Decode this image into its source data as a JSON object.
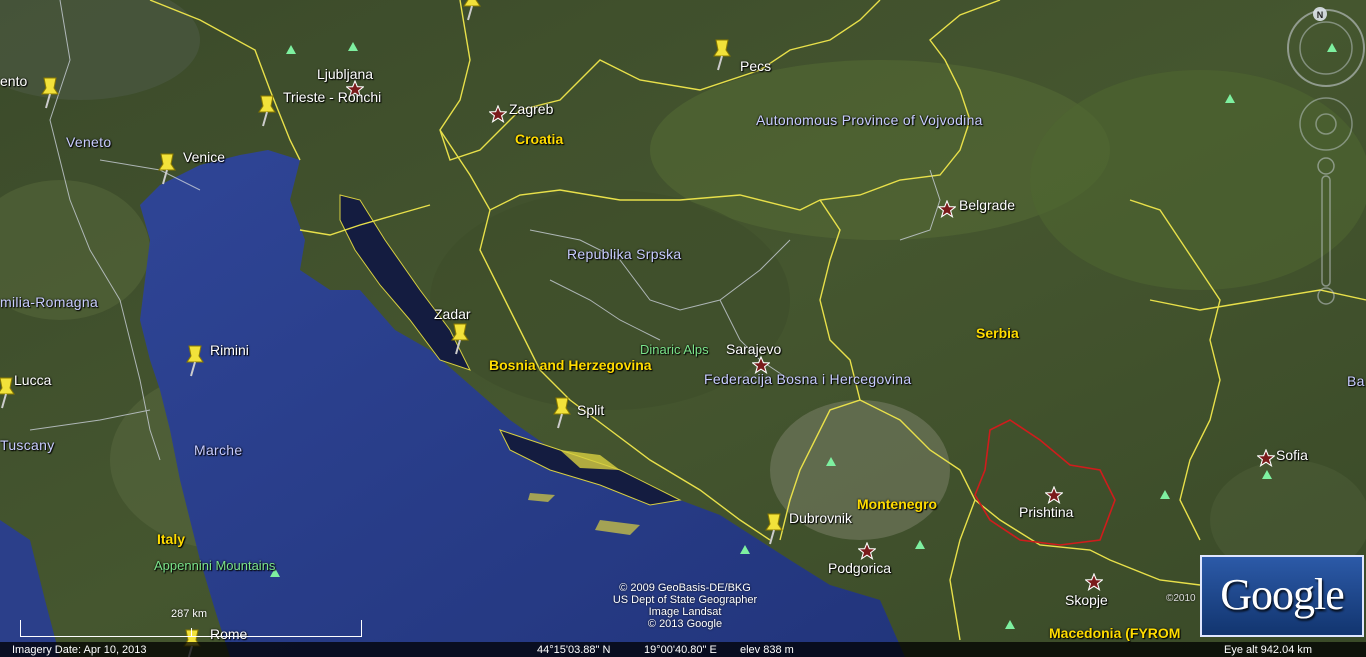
{
  "map": {
    "labels": [
      {
        "key": "Ljubljana",
        "text": "Ljubljana",
        "cls": "city",
        "name": "label-ljubljana"
      },
      {
        "key": "TriesteRonchi",
        "text": "Trieste - Ronchi",
        "cls": "city",
        "name": "label-trieste-ronchi"
      },
      {
        "key": "Zagreb",
        "text": "Zagreb",
        "cls": "city",
        "name": "label-zagreb"
      },
      {
        "key": "Croatia",
        "text": "Croatia",
        "cls": "country",
        "name": "label-croatia"
      },
      {
        "key": "Pecs",
        "text": "Pecs",
        "cls": "city",
        "name": "label-pecs"
      },
      {
        "key": "Vojvodina",
        "text": "Autonomous Province of Vojvodina",
        "cls": "region",
        "name": "label-vojvodina"
      },
      {
        "key": "Belgrade",
        "text": "Belgrade",
        "cls": "city",
        "name": "label-belgrade"
      },
      {
        "key": "Veneto",
        "text": "Veneto",
        "cls": "region",
        "name": "label-veneto"
      },
      {
        "key": "Venice",
        "text": "Venice",
        "cls": "city",
        "name": "label-venice"
      },
      {
        "key": "ento",
        "text": "ento",
        "cls": "city",
        "name": "label-ento"
      },
      {
        "key": "EmiliaRomagna",
        "text": "milia-Romagna",
        "cls": "region",
        "name": "label-emilia-romagna"
      },
      {
        "key": "Rimini",
        "text": "Rimini",
        "cls": "city",
        "name": "label-rimini"
      },
      {
        "key": "Lucca",
        "text": "Lucca",
        "cls": "city",
        "name": "label-lucca"
      },
      {
        "key": "Tuscany",
        "text": "Tuscany",
        "cls": "region",
        "name": "label-tuscany"
      },
      {
        "key": "Marche",
        "text": "Marche",
        "cls": "region",
        "name": "label-marche"
      },
      {
        "key": "Italy",
        "text": "Italy",
        "cls": "country",
        "name": "label-italy"
      },
      {
        "key": "Appennini",
        "text": "Appennini Mountains",
        "cls": "nature",
        "name": "label-appennini-mountains"
      },
      {
        "key": "Rome",
        "text": "Rome",
        "cls": "city",
        "name": "label-rome"
      },
      {
        "key": "RepublikaSrpska",
        "text": "Republika Srpska",
        "cls": "region",
        "name": "label-republika-srpska"
      },
      {
        "key": "Zadar",
        "text": "Zadar",
        "cls": "city",
        "name": "label-zadar"
      },
      {
        "key": "BiH",
        "text": "Bosnia and Herzegovina",
        "cls": "country",
        "name": "label-bosnia-and-herzegovina"
      },
      {
        "key": "Dinaric",
        "text": "Dinaric Alps",
        "cls": "nature",
        "name": "label-dinaric-alps"
      },
      {
        "key": "Sarajevo",
        "text": "Sarajevo",
        "cls": "city",
        "name": "label-sarajevo"
      },
      {
        "key": "Federacija",
        "text": "Federacija Bosna i Hercegovina",
        "cls": "region",
        "name": "label-federacija"
      },
      {
        "key": "Split",
        "text": "Split",
        "cls": "city",
        "name": "label-split"
      },
      {
        "key": "Serbia",
        "text": "Serbia",
        "cls": "country",
        "name": "label-serbia"
      },
      {
        "key": "Montenegro",
        "text": "Montenegro",
        "cls": "country",
        "name": "label-montenegro"
      },
      {
        "key": "Dubrovnik",
        "text": "Dubrovnik",
        "cls": "city",
        "name": "label-dubrovnik"
      },
      {
        "key": "Podgorica",
        "text": "Podgorica",
        "cls": "city",
        "name": "label-podgorica"
      },
      {
        "key": "Prishtina",
        "text": "Prishtina",
        "cls": "city",
        "name": "label-prishtina"
      },
      {
        "key": "Sofia",
        "text": "Sofia",
        "cls": "city",
        "name": "label-sofia"
      },
      {
        "key": "Skopje",
        "text": "Skopje",
        "cls": "city",
        "name": "label-skopje"
      },
      {
        "key": "Macedonia",
        "text": "Macedonia (FYROM",
        "cls": "country",
        "name": "label-macedonia"
      },
      {
        "key": "Ba",
        "text": "Ba",
        "cls": "region",
        "name": "label-ba"
      }
    ]
  },
  "attribution": {
    "line1": "© 2009 GeoBasis-DE/BKG",
    "line2": "US Dept of State Geographer",
    "line3": "Image Landsat",
    "line4": "© 2013 Google"
  },
  "side_year": "©2010",
  "scale": {
    "label": "287 km"
  },
  "logo": {
    "text": "Google"
  },
  "compass": {
    "north": "N"
  },
  "status": {
    "imagery_date": "Imagery Date: Apr 10, 2013",
    "lat": "44°15'03.88\" N",
    "lon": "19°00'40.80\" E",
    "elev": "elev  838 m",
    "eye_alt": "Eye alt  942.04 km"
  },
  "colors": {
    "sea": "#2a3f8f",
    "border_country": "#e8e04a",
    "border_kosovo": "#d01c1c",
    "label_city": "#ffffff",
    "label_country": "#ffdc00",
    "label_region": "#c8ccff",
    "label_nature": "#7be38a"
  }
}
